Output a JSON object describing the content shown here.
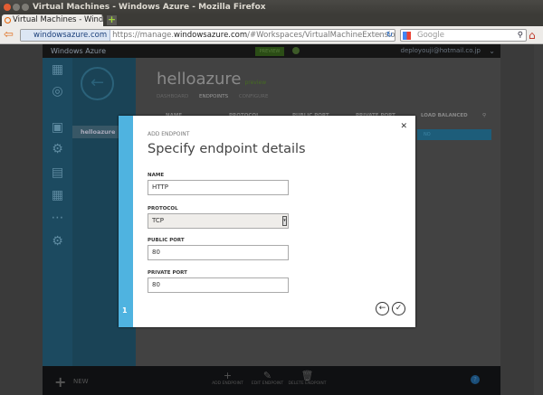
{
  "browser": {
    "window_title": "Virtual Machines - Windows Azure - Mozilla Firefox",
    "tab_title": "Virtual Machines - Windows Az...",
    "site_identity": "windowsazure.com",
    "url_prefix": "https://manage.",
    "url_domain": "windowsazure.com",
    "url_path": "/#Workspaces/VirtualMachineExtension/VirtualM",
    "search_placeholder": "Google"
  },
  "azure": {
    "brand": "Windows Azure",
    "preview_badge": "PREVIEW",
    "user_email": "deployouji@hotmail.co.jp",
    "selected_item": "helloazure",
    "page_title": "helloazure",
    "page_badge": "preview",
    "tabs": [
      "DASHBOARD",
      "ENDPOINTS",
      "CONFIGURE"
    ],
    "columns": [
      "NAME",
      "PROTOCOL",
      "PUBLIC PORT",
      "PRIVATE PORT",
      "LOAD BALANCED"
    ],
    "row_value": "NO",
    "new_label": "NEW",
    "actions": [
      "ADD ENDPOINT",
      "EDIT ENDPOINT",
      "DELETE ENDPOINT"
    ],
    "help": "?"
  },
  "modal": {
    "caption": "ADD ENDPOINT",
    "title": "Specify endpoint details",
    "step": "1",
    "fields": {
      "name_label": "NAME",
      "name_value": "HTTP",
      "protocol_label": "PROTOCOL",
      "protocol_value": "TCP",
      "public_port_label": "PUBLIC PORT",
      "public_port_value": "80",
      "private_port_label": "PRIVATE PORT",
      "private_port_value": "80"
    }
  },
  "colors": {
    "accent": "#4fb3e0",
    "sidebar": "#1c4a60"
  }
}
